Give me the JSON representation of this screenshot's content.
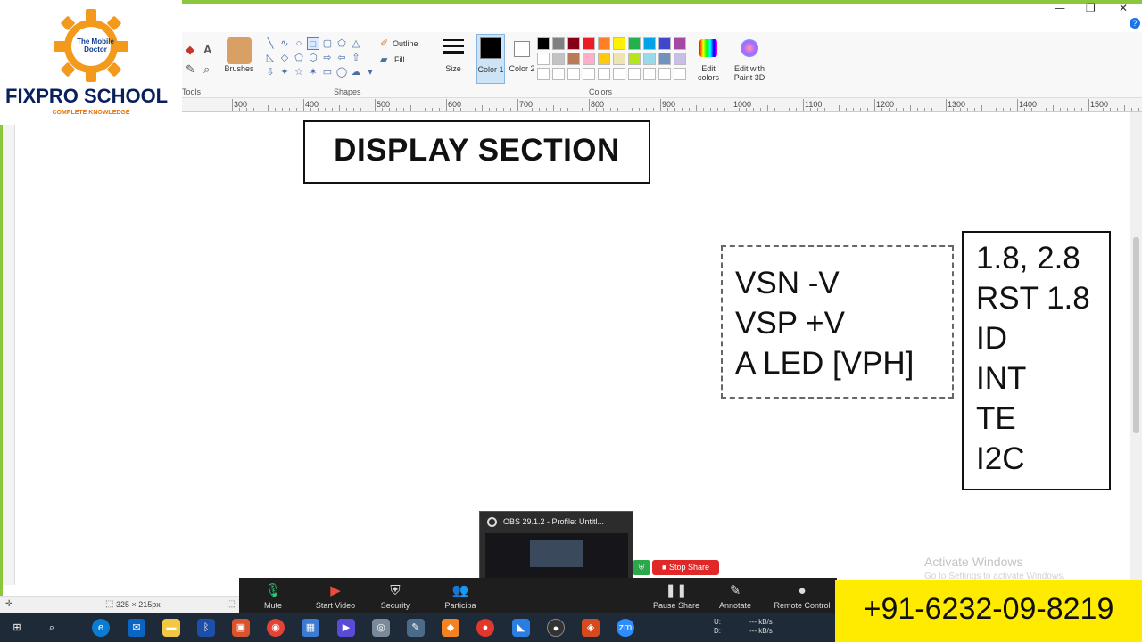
{
  "logo": {
    "brand": "FIXPRO SCHOOL",
    "tagline": "COMPLETE KNOWLEDGE",
    "inner_text": "The Mobile Doctor",
    "gear_color": "#f39a1d",
    "brand_color": "#0a1f5c"
  },
  "ribbon": {
    "tools_label": "Tools",
    "brushes_label": "Brushes",
    "shapes_label": "Shapes",
    "outline_label": "Outline",
    "fill_label": "Fill",
    "size_label": "Size",
    "color1_label": "Color 1",
    "color2_label": "Color 2",
    "colors_label": "Colors",
    "edit_colors_label": "Edit colors",
    "paint3d_label": "Edit with Paint 3D",
    "palette_row1": [
      "#000000",
      "#7f7f7f",
      "#880015",
      "#ed1c24",
      "#ff7f27",
      "#fff200",
      "#22b14c",
      "#00a2e8",
      "#3f48cc",
      "#a349a4"
    ],
    "palette_row2": [
      "#ffffff",
      "#c3c3c3",
      "#b97a57",
      "#ffaec9",
      "#ffc90e",
      "#efe4b0",
      "#b5e61d",
      "#99d9ea",
      "#7092be",
      "#c8bfe7"
    ]
  },
  "ruler": {
    "ticks": [
      "300",
      "400",
      "500",
      "600",
      "700",
      "800",
      "900",
      "1000",
      "1100",
      "1200",
      "1300",
      "1400",
      "1500"
    ]
  },
  "canvas": {
    "title": "DISPLAY SECTION",
    "left_box": [
      "VSN -V",
      "VSP +V",
      "A LED [VPH]"
    ],
    "right_box": [
      "1.8,  2.8",
      "RST 1.8",
      "ID",
      "INT",
      "TE",
      "I2C"
    ]
  },
  "status": {
    "selection_size": "325 × 215px"
  },
  "zoom": {
    "mute": "Mute",
    "start_video": "Start Video",
    "security": "Security",
    "participants": "Participa",
    "pause_share": "Pause Share",
    "annotate": "Annotate",
    "remote_control": "Remote Control",
    "stop_share": "Stop Share"
  },
  "obs": {
    "title": "OBS 29.1.2 - Profile: Untitl..."
  },
  "watermark": {
    "line1": "Activate Windows",
    "line2": "Go to Settings to activate Windows."
  },
  "phone": "+91-6232-09-8219",
  "taskbar": {
    "net_labels": [
      "U:",
      "D:"
    ],
    "net_values": [
      "--- kB/s",
      "--- kB/s"
    ]
  }
}
